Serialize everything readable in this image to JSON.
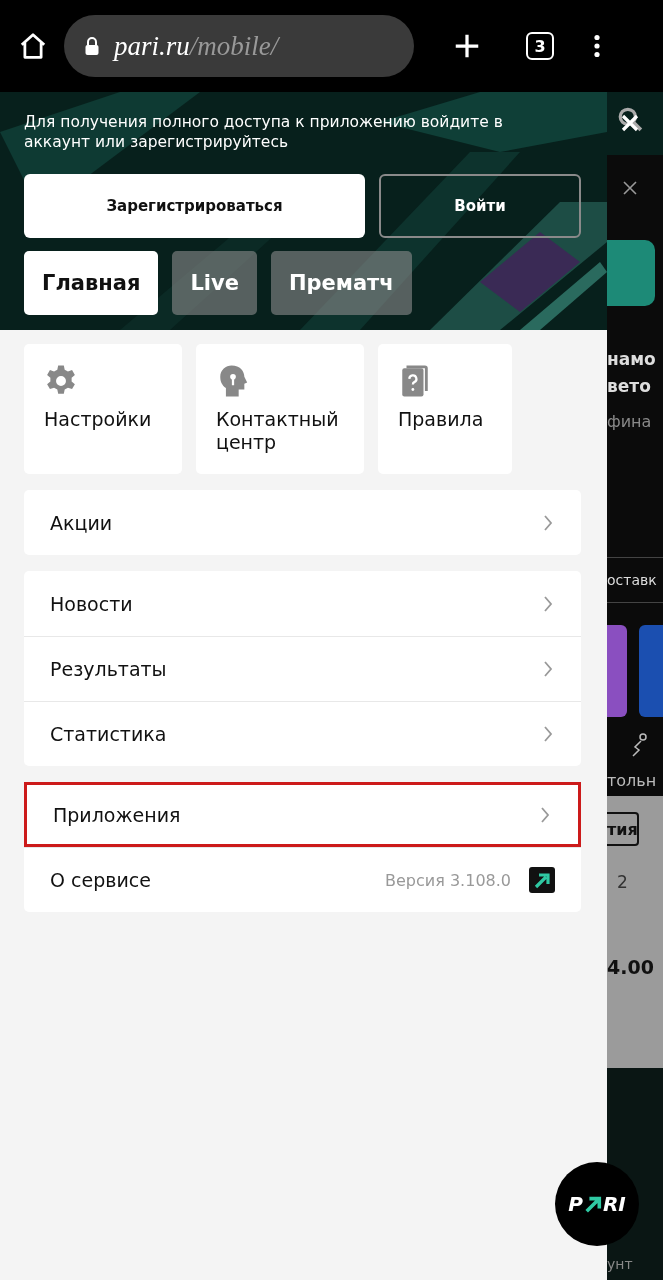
{
  "browser": {
    "domain": "pari.ru",
    "path": "/mobile/",
    "tab_count": "3"
  },
  "banner": {
    "message": "Для получения полного доступа к приложению войдите в аккаунт или зарегистрируйтесь",
    "register": "Зарегистрироваться",
    "login": "Войти"
  },
  "tabs": [
    {
      "label": "Главная",
      "selected": true
    },
    {
      "label": "Live",
      "selected": false
    },
    {
      "label": "Прематч",
      "selected": false
    }
  ],
  "tiles": [
    {
      "kind": "settings",
      "label": "Настройки"
    },
    {
      "kind": "contact",
      "label": "Контактный центр"
    },
    {
      "kind": "rules",
      "label": "Правила"
    }
  ],
  "menu_groups": [
    [
      {
        "kind": "link",
        "label": "Акции",
        "highlighted": false
      }
    ],
    [
      {
        "kind": "link",
        "label": "Новости",
        "highlighted": false
      },
      {
        "kind": "link",
        "label": "Результаты",
        "highlighted": false
      },
      {
        "kind": "link",
        "label": "Статистика",
        "highlighted": false
      }
    ],
    [
      {
        "kind": "link",
        "label": "Приложения",
        "highlighted": true
      },
      {
        "kind": "about",
        "label": "О сервисе",
        "version": "Версия 3.108.0",
        "highlighted": false
      }
    ]
  ],
  "background_page": {
    "title_lines": [
      "намо",
      "вето"
    ],
    "subtitle": "фина",
    "filter": "оставк",
    "sport": "тольн",
    "chip": "тия",
    "column": "2",
    "odds": "4.00",
    "nav": "унт"
  },
  "logo": {
    "left": "P",
    "right": "RI"
  }
}
